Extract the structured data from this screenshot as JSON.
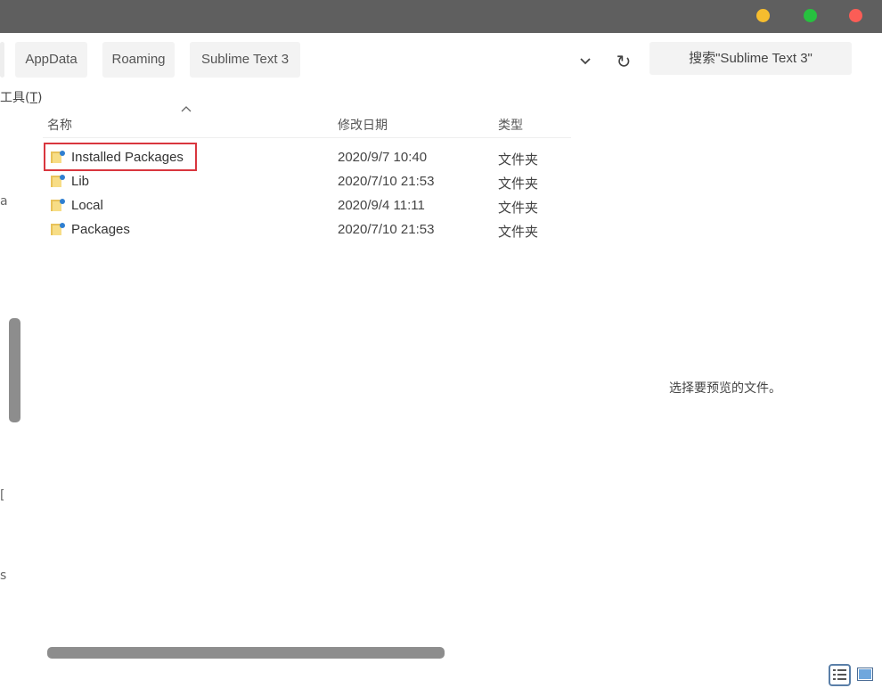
{
  "window": {
    "colors": {
      "titlebar": "#5f5f5f",
      "minimize": "#f6bd2e",
      "maximize": "#27c13f",
      "close": "#fb5d56"
    }
  },
  "breadcrumb": [
    "AppData",
    "Roaming",
    "Sublime Text 3"
  ],
  "nav": {
    "dropdown_icon": "chevron-down-icon",
    "refresh_icon": "refresh-icon",
    "refresh_glyph": "↻"
  },
  "search": {
    "placeholder": "搜索\"Sublime Text 3\""
  },
  "menu": {
    "tools_label": "工具(",
    "tools_key": "T",
    "tools_close": ")"
  },
  "columns": {
    "name": "名称",
    "date": "修改日期",
    "type": "类型"
  },
  "files": [
    {
      "name": "Installed Packages",
      "date": "2020/9/7 10:40",
      "type": "文件夹",
      "highlighted": true
    },
    {
      "name": "Lib",
      "date": "2020/7/10 21:53",
      "type": "文件夹"
    },
    {
      "name": "Local",
      "date": "2020/9/4 11:11",
      "type": "文件夹"
    },
    {
      "name": "Packages",
      "date": "2020/7/10 21:53",
      "type": "文件夹"
    }
  ],
  "sidebar_fragments": [
    "a",
    "[",
    "s"
  ],
  "preview": {
    "message": "选择要预览的文件。"
  },
  "highlight_color": "#d9363e"
}
